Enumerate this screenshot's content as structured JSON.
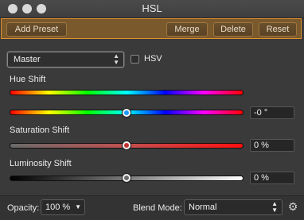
{
  "window": {
    "title": "HSL"
  },
  "toolbar": {
    "add_preset": "Add Preset",
    "merge": "Merge",
    "delete": "Delete",
    "reset": "Reset"
  },
  "channel": {
    "selected": "Master",
    "hsv_label": "HSV",
    "hsv_checked": false
  },
  "hue_shift": {
    "label": "Hue Shift",
    "value": "-0 °",
    "level": 0.5
  },
  "saturation_shift": {
    "label": "Saturation Shift",
    "value": "0 %",
    "level": 0.5
  },
  "luminosity_shift": {
    "label": "Luminosity Shift",
    "value": "0 %",
    "level": 0.5
  },
  "footer": {
    "opacity_label": "Opacity:",
    "opacity_value": "100 %",
    "blend_label": "Blend Mode:",
    "blend_value": "Normal"
  },
  "colors": {
    "accent_border": "#e0902e",
    "toolbar_bg": "#7a5a2c"
  },
  "icons": {
    "settings": "gear-icon",
    "window_controls": [
      "close-icon",
      "minimize-icon",
      "zoom-icon"
    ]
  }
}
